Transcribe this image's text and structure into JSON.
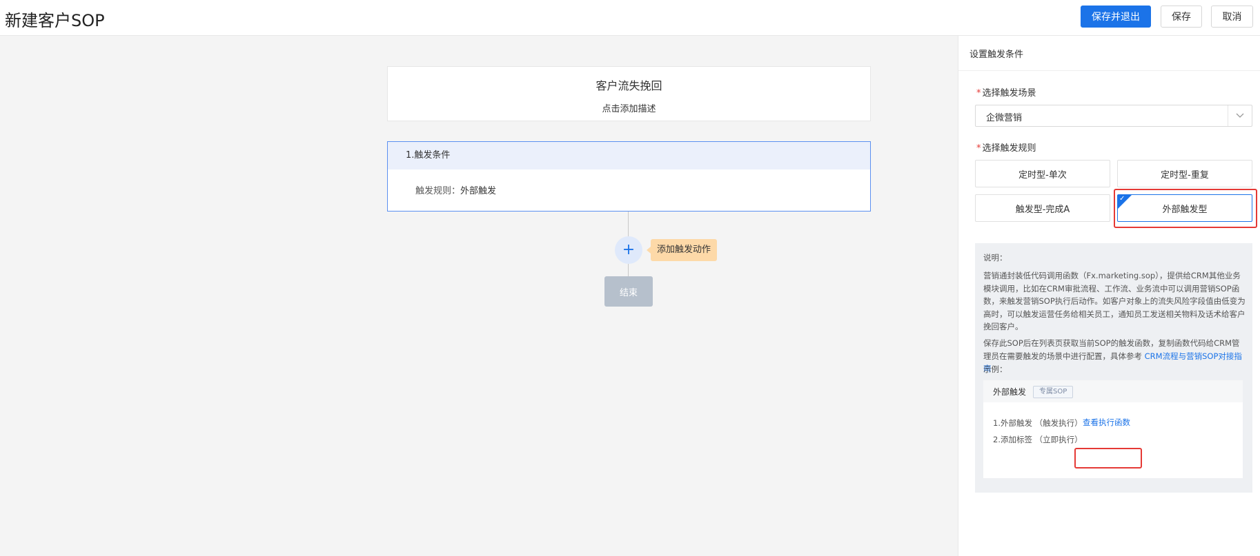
{
  "header": {
    "title": "新建客户SOP",
    "save_exit_label": "保存并退出",
    "save_label": "保存",
    "cancel_label": "取消"
  },
  "flow": {
    "sop_name": "客户流失挽回",
    "sop_desc": "点击添加描述",
    "trigger_title": "1.触发条件",
    "trigger_rule_key": "触发规则：",
    "trigger_rule_value": "外部触发",
    "add_action_label": "添加触发动作",
    "end_label": "结束"
  },
  "panel": {
    "title": "设置触发条件",
    "scene_label": "选择触发场景",
    "scene_value": "企微营销",
    "rule_label": "选择触发规则",
    "rules": [
      {
        "label": "定时型-单次",
        "selected": false
      },
      {
        "label": "定时型-重复",
        "selected": false
      },
      {
        "label": "触发型-完成A",
        "selected": false
      },
      {
        "label": "外部触发型",
        "selected": true
      }
    ],
    "info": {
      "heading": "说明：",
      "para1": "营销通封装低代码调用函数（Fx.marketing.sop），提供给CRM其他业务模块调用，比如在CRM审批流程、工作流、业务流中可以调用营销SOP函数，来触发营销SOP执行后动作。如客户对象上的流失风险字段值由低变为高时，可以触发运营任务给相关员工，通知员工发送相关物料及话术给客户挽回客户。",
      "para2": "保存此SOP后在列表页获取当前SOP的触发函数，复制函数代码给CRM管理员在需要触发的场景中进行配置，具体参考 ",
      "para2_link": "CRM流程与营销SOP对接指南",
      "example_label": "示例：",
      "example": {
        "title": "外部触发",
        "badge": "专属SOP",
        "line1": "1.外部触发 （触发执行）",
        "line1_link": "查看执行函数",
        "line2": "2.添加标签 （立即执行）"
      }
    }
  },
  "colors": {
    "primary": "#1b73e8",
    "highlight_red": "#e53935",
    "tip_bg": "#fdd9a8"
  }
}
